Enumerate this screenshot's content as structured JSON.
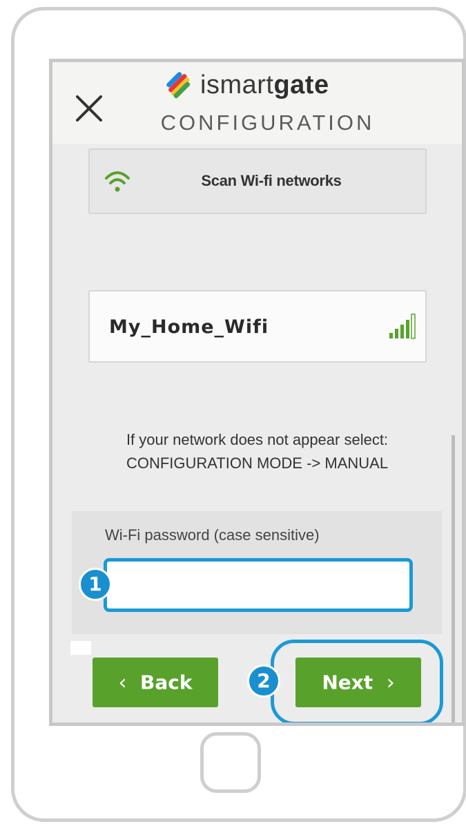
{
  "brand": {
    "name_light": "ismart",
    "name_bold": "gate",
    "subtitle": "CONFIGURATION"
  },
  "scan": {
    "label": "Scan Wi-fi networks",
    "icon": "wifi-icon"
  },
  "network": {
    "name": "My_Home_Wifi",
    "icon": "signal-strength-icon"
  },
  "help": {
    "line1": "If your network does not appear select:",
    "line2": "CONFIGURATION MODE -> MANUAL"
  },
  "password": {
    "label": "Wi-Fi password (case sensitive)",
    "value": ""
  },
  "buttons": {
    "back": "Back",
    "next": "Next"
  },
  "callouts": {
    "one": "1",
    "two": "2"
  },
  "colors": {
    "accent_green": "#58a22c",
    "callout_blue": "#1a9ad6"
  }
}
